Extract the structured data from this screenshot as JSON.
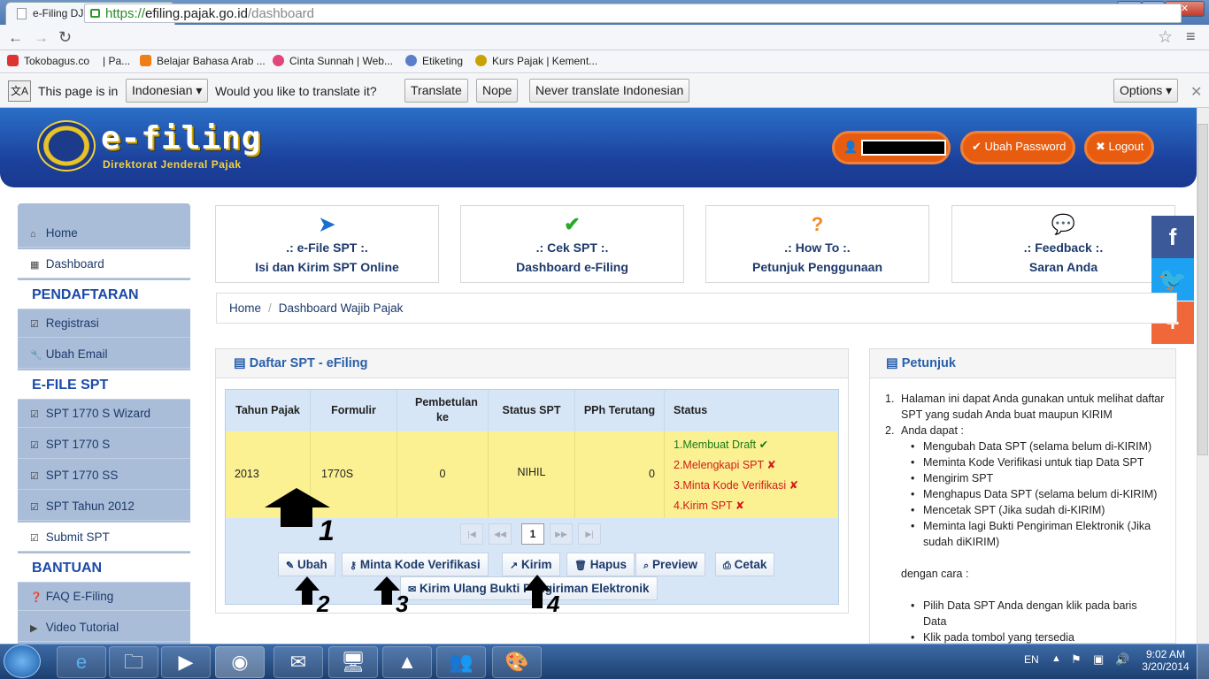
{
  "browser": {
    "tab_title": "e-Filing DJP",
    "url_https": "https://",
    "url_domain": "efiling.pajak.go.id",
    "url_path": "/dashboard",
    "bookmarks": [
      "Tokobagus.co",
      "| Pa...",
      "Belajar Bahasa Arab ...",
      "Cinta Sunnah | Web...",
      "Etiketing",
      "Kurs Pajak | Kement..."
    ],
    "translate": {
      "prefix": "This page is in",
      "language": "Indonesian",
      "question": "Would you like to translate it?",
      "translate_btn": "Translate",
      "nope_btn": "Nope",
      "never_btn": "Never translate Indonesian",
      "options_btn": "Options"
    }
  },
  "header": {
    "logo_title": "e-filing",
    "logo_subtitle": "Direktorat Jenderal Pajak",
    "ubah_password": "Ubah Password",
    "logout": "Logout"
  },
  "sidebar": {
    "home": "Home",
    "dashboard": "Dashboard",
    "pendaftaran": "PENDAFTARAN",
    "registrasi": "Registrasi",
    "ubah_email": "Ubah Email",
    "efile_spt": "E-FILE SPT",
    "spt_1770s_wizard": "SPT 1770 S Wizard",
    "spt_1770s": "SPT 1770 S",
    "spt_1770ss": "SPT 1770 SS",
    "spt_2012": "SPT Tahun 2012",
    "submit_spt": "Submit SPT",
    "bantuan": "BANTUAN",
    "faq": "FAQ E-Filing",
    "video": "Video Tutorial"
  },
  "quick_boxes": [
    {
      "line1": ".: e-File SPT :.",
      "line2": "Isi dan Kirim SPT Online"
    },
    {
      "line1": ".: Cek SPT :.",
      "line2": "Dashboard e-Filing"
    },
    {
      "line1": ".: How To :.",
      "line2": "Petunjuk Penggunaan"
    },
    {
      "line1": ".: Feedback :.",
      "line2": "Saran Anda"
    }
  ],
  "breadcrumb": {
    "home": "Home",
    "current": "Dashboard Wajib Pajak"
  },
  "daftar": {
    "title": "Daftar SPT - eFiling",
    "headers": [
      "Tahun Pajak",
      "Formulir",
      "Pembetulan ke",
      "Status SPT",
      "PPh Terutang",
      "Status"
    ],
    "row": {
      "tahun": "2013",
      "formulir": "1770S",
      "pembetulan": "0",
      "status_spt": "NIHIL",
      "pph": "0",
      "status": [
        "1.Membuat Draft ✔",
        "2.Melengkapi SPT ✘",
        "3.Minta Kode Verifikasi ✘",
        "4.Kirim SPT ✘"
      ]
    },
    "page": "1",
    "actions": {
      "ubah": "Ubah",
      "minta_kode": "Minta Kode Verifikasi",
      "kirim": "Kirim",
      "hapus": "Hapus",
      "preview": "Preview",
      "cetak": "Cetak",
      "kirim_ulang": "Kirim Ulang Bukti Pengiriman Elektronik"
    },
    "annotations": [
      "1",
      "2",
      "3",
      "4"
    ]
  },
  "petunjuk": {
    "title": "Petunjuk",
    "item1": "Halaman ini dapat Anda gunakan untuk melihat daftar SPT yang sudah Anda buat maupun KIRIM",
    "item2": "Anda dapat :",
    "bullets": [
      "Mengubah Data SPT (selama belum di-KIRIM)",
      "Meminta Kode Verifikasi untuk tiap Data SPT",
      "Mengirim SPT",
      "Menghapus Data SPT (selama belum di-KIRIM)",
      "Mencetak SPT (Jika sudah di-KIRIM)",
      "Meminta lagi Bukti Pengiriman Elektronik (Jika sudah diKIRIM)"
    ],
    "dengan_cara": "dengan cara :",
    "bullets2": [
      "Pilih Data SPT Anda dengan klik pada baris Data",
      "Klik pada tombol yang tersedia"
    ]
  },
  "taskbar": {
    "lang": "EN",
    "time": "9:02 AM",
    "date": "3/20/2014"
  },
  "colors": {
    "header_blue": "#1b3f9a",
    "orange": "#e85c10",
    "facebook": "#3b5998",
    "twitter": "#1da1f2",
    "plus": "#f0683a",
    "row_yellow": "#fcf192"
  }
}
